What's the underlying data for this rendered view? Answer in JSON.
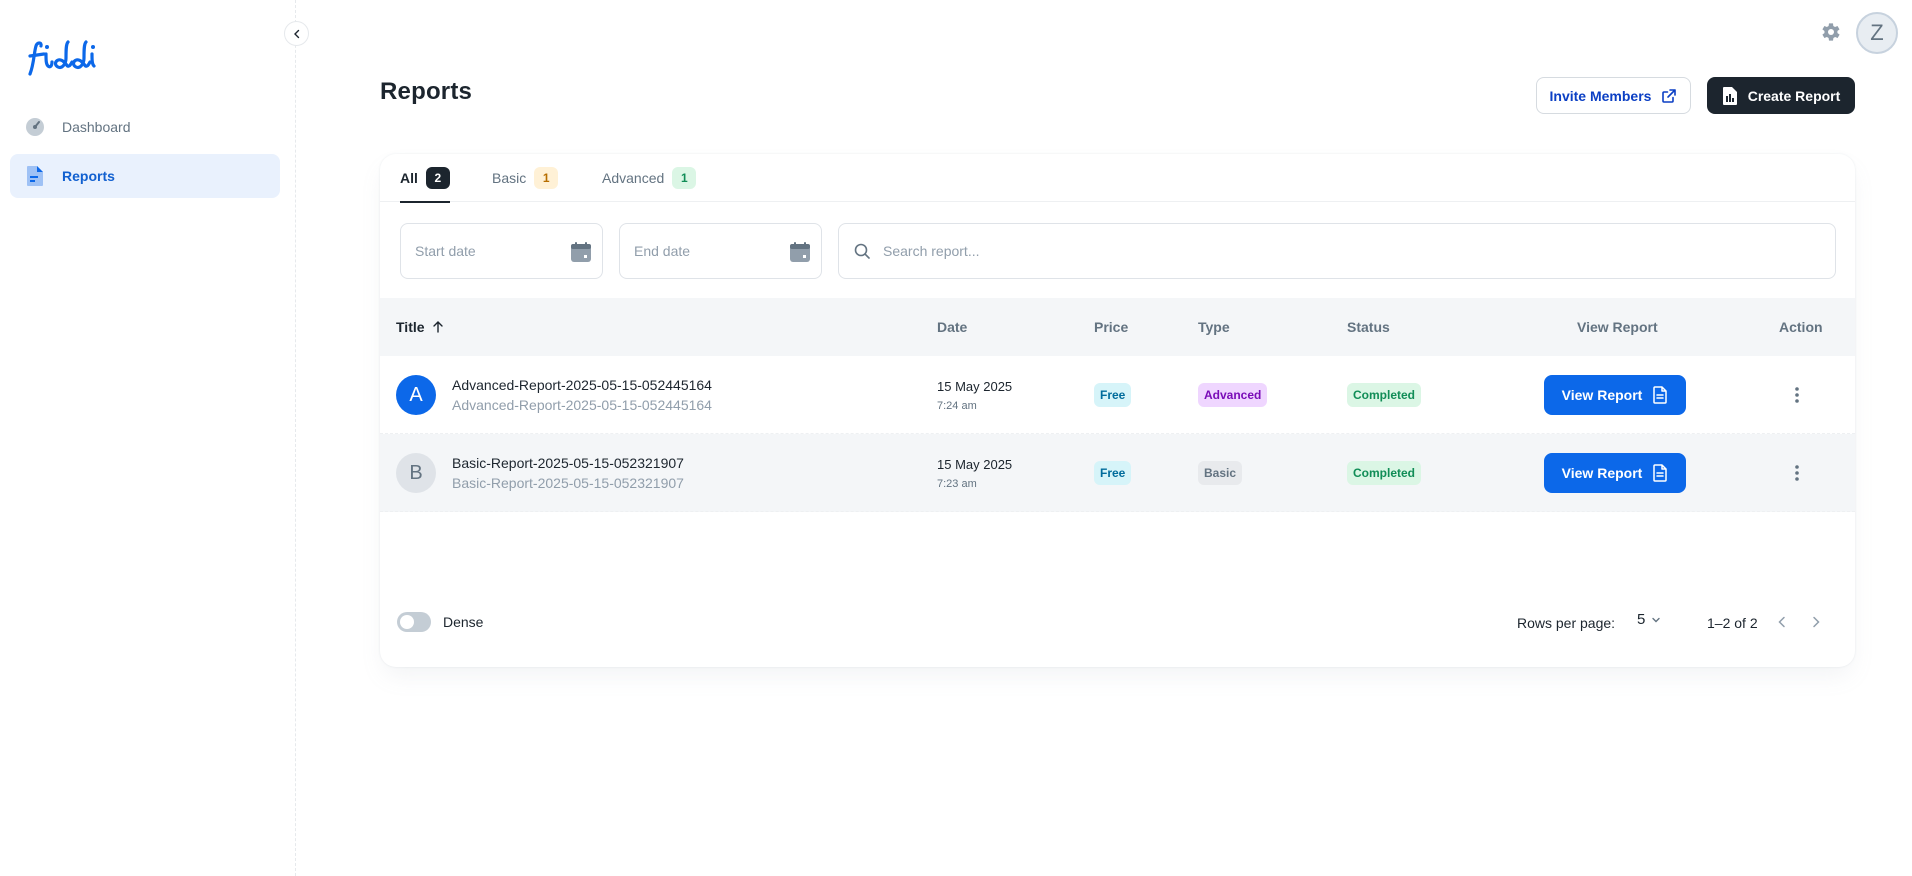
{
  "brand": {
    "logo_text": "fiddi",
    "color": "#0c68e9"
  },
  "sidebar": {
    "items": [
      {
        "label": "Dashboard",
        "icon": "dashboard-icon",
        "active": false
      },
      {
        "label": "Reports",
        "icon": "file-icon",
        "active": true
      }
    ]
  },
  "header": {
    "user_initial": "Z"
  },
  "page": {
    "title": "Reports",
    "invite_label": "Invite Members",
    "create_label": "Create Report"
  },
  "tabs": [
    {
      "label": "All",
      "count": "2"
    },
    {
      "label": "Basic",
      "count": "1"
    },
    {
      "label": "Advanced",
      "count": "1"
    }
  ],
  "filters": {
    "start_placeholder": "Start date",
    "end_placeholder": "End date",
    "search_placeholder": "Search report..."
  },
  "table": {
    "headers": [
      "Title",
      "Date",
      "Price",
      "Type",
      "Status",
      "View Report",
      "Action"
    ],
    "rows": [
      {
        "initial": "A",
        "title": "Advanced-Report-2025-05-15-052445164",
        "subtitle": "Advanced-Report-2025-05-15-052445164",
        "date": "15 May 2025",
        "time": "7:24 am",
        "price": "Free",
        "type": "Advanced",
        "status": "Completed",
        "view_label": "View Report"
      },
      {
        "initial": "B",
        "title": "Basic-Report-2025-05-15-052321907",
        "subtitle": "Basic-Report-2025-05-15-052321907",
        "date": "15 May 2025",
        "time": "7:23 am",
        "price": "Free",
        "type": "Basic",
        "status": "Completed",
        "view_label": "View Report"
      }
    ]
  },
  "footer": {
    "dense_label": "Dense",
    "rows_per_page_label": "Rows per page:",
    "rows_per_page": "5",
    "range": "1–2 of 2"
  }
}
